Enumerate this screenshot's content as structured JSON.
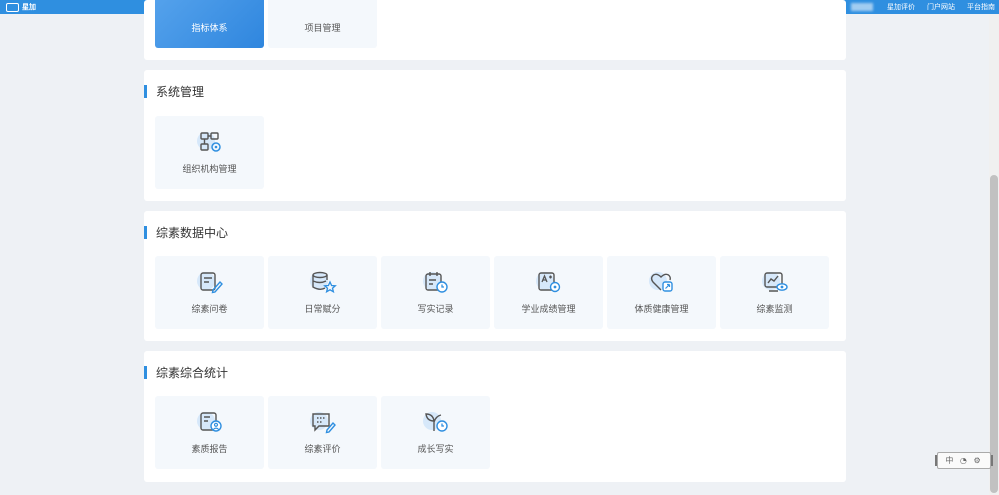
{
  "header": {
    "logo_text": "星加",
    "links": [
      "星加评价",
      "门户网站",
      "平台指南"
    ]
  },
  "colors": {
    "primary": "#2f8fe0",
    "tile_bg": "#f4f8fc",
    "page_bg": "#eef1f5"
  },
  "top_section": {
    "tiles": [
      {
        "label": "指标体系",
        "active": true
      },
      {
        "label": "项目管理",
        "active": false
      }
    ]
  },
  "system_section": {
    "title": "系统管理",
    "tiles": [
      {
        "label": "组织机构管理",
        "icon": "org-structure-icon"
      }
    ]
  },
  "data_center_section": {
    "title": "综素数据中心",
    "tiles": [
      {
        "label": "综素问卷",
        "icon": "questionnaire-icon"
      },
      {
        "label": "日常赋分",
        "icon": "daily-score-icon"
      },
      {
        "label": "写实记录",
        "icon": "record-calendar-icon"
      },
      {
        "label": "学业成绩管理",
        "icon": "grade-settings-icon"
      },
      {
        "label": "体质健康管理",
        "icon": "health-heart-icon"
      },
      {
        "label": "综素监测",
        "icon": "monitor-chart-icon"
      }
    ]
  },
  "stats_section": {
    "title": "综素综合统计",
    "tiles": [
      {
        "label": "素质报告",
        "icon": "report-person-icon"
      },
      {
        "label": "综素评价",
        "icon": "evaluation-chat-icon"
      },
      {
        "label": "成长写实",
        "icon": "growth-plant-icon"
      }
    ]
  },
  "floating_badge": {
    "text": "中 ◔ ⚙"
  }
}
